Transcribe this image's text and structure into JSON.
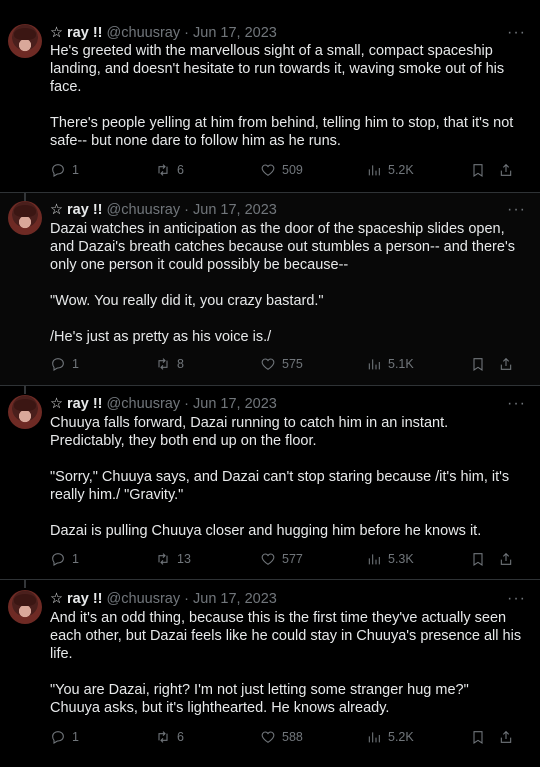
{
  "tweets": [
    {
      "name": "☆ ray !!",
      "handle": "@chuusray",
      "sep": "·",
      "date": "Jun 17, 2023",
      "paragraphs": [
        "He's greeted with the marvellous sight of a small, compact spaceship landing, and doesn't hesitate to run towards it, waving smoke out of his face.",
        "There's people yelling at him from behind, telling him to stop, that it's not safe-- but none dare to follow him as he runs."
      ],
      "replies": "1",
      "reposts": "6",
      "likes": "509",
      "views": "5.2K"
    },
    {
      "name": "☆ ray !!",
      "handle": "@chuusray",
      "sep": "·",
      "date": "Jun 17, 2023",
      "paragraphs": [
        "Dazai watches in anticipation as the door of the spaceship slides open, and Dazai's breath catches because out stumbles a person-- and there's only one person it could possibly be because--",
        "\"Wow. You really did it, you crazy bastard.\"",
        "/He's just as pretty as his voice is./"
      ],
      "replies": "1",
      "reposts": "8",
      "likes": "575",
      "views": "5.1K"
    },
    {
      "name": "☆ ray !!",
      "handle": "@chuusray",
      "sep": "·",
      "date": "Jun 17, 2023",
      "paragraphs": [
        "Chuuya falls forward, Dazai running to catch him in an instant. Predictably, they both end up on the floor.",
        "\"Sorry,\" Chuuya says, and Dazai can't stop staring because /it's him, it's really him./ \"Gravity.\"",
        "Dazai is pulling Chuuya closer and hugging him before he knows it."
      ],
      "replies": "1",
      "reposts": "13",
      "likes": "577",
      "views": "5.3K"
    },
    {
      "name": "☆ ray !!",
      "handle": "@chuusray",
      "sep": "·",
      "date": "Jun 17, 2023",
      "paragraphs": [
        "And it's an odd thing, because this is the first time they've actually seen each other, but Dazai feels like he could stay in Chuuya's presence all his life.",
        "\"You are Dazai, right? I'm not just letting some stranger hug me?\" Chuuya asks, but it's lighthearted. He knows already."
      ],
      "replies": "1",
      "reposts": "6",
      "likes": "588",
      "views": "5.2K"
    }
  ],
  "more_label": "···",
  "colors": {
    "background": "#000000",
    "text": "#e7e9ea",
    "muted": "#71767b",
    "border": "#2f3336"
  }
}
